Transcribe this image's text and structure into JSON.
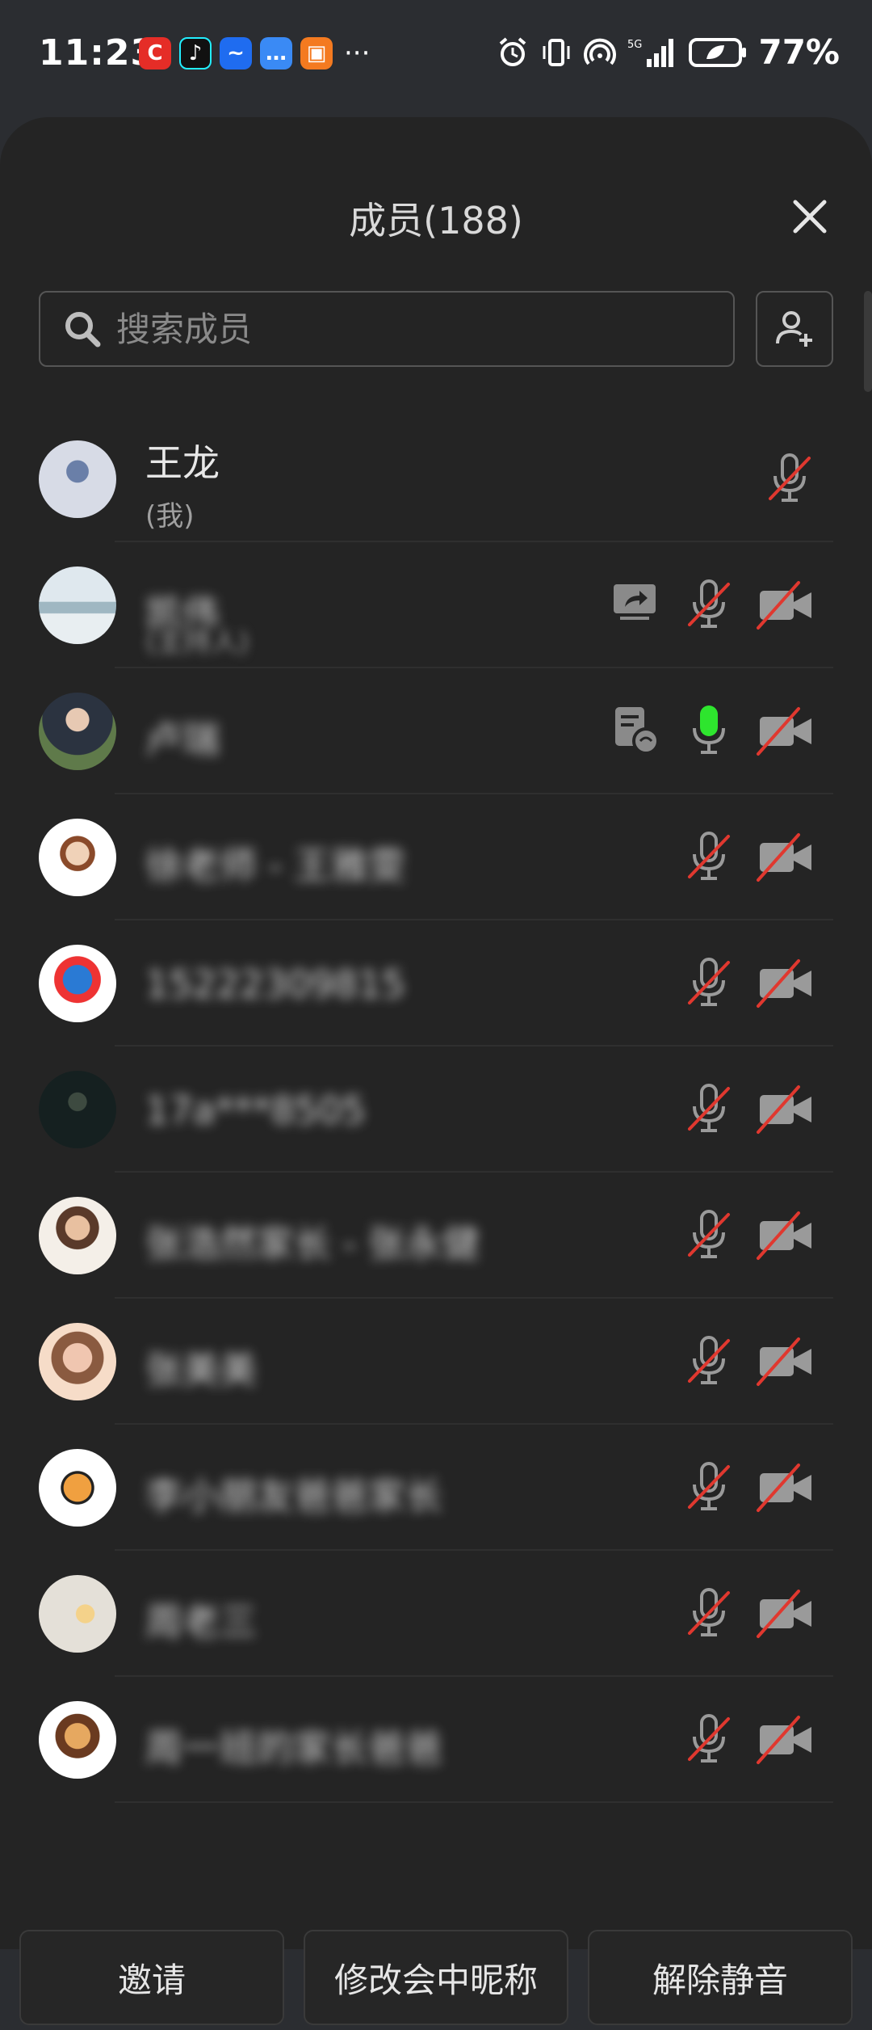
{
  "status_bar": {
    "time": "11:23",
    "battery": "77%",
    "signal_label": "5G"
  },
  "header": {
    "title": "成员(188)"
  },
  "search": {
    "placeholder": "搜索成员"
  },
  "members": [
    {
      "name": "王龙",
      "sub": "(我)",
      "blurred": false,
      "me": true,
      "mic": "muted",
      "camera": "none",
      "extra": "none"
    },
    {
      "name": "凯伟",
      "sub": "(主持人)",
      "blurred": true,
      "me": false,
      "mic": "muted",
      "camera": "off",
      "extra": "share"
    },
    {
      "name": "卢瑞",
      "sub": "",
      "blurred": true,
      "me": false,
      "mic": "active",
      "camera": "off",
      "extra": "note"
    },
    {
      "name": "徐老师 - 王雅雯",
      "sub": "",
      "blurred": true,
      "me": false,
      "mic": "muted",
      "camera": "off",
      "extra": "none"
    },
    {
      "name": "15222309815",
      "sub": "",
      "blurred": true,
      "me": false,
      "mic": "muted",
      "camera": "off",
      "extra": "none"
    },
    {
      "name": "17a***8505",
      "sub": "",
      "blurred": true,
      "me": false,
      "mic": "muted",
      "camera": "off",
      "extra": "none"
    },
    {
      "name": "张浩然家长 - 张永健",
      "sub": "",
      "blurred": true,
      "me": false,
      "mic": "muted",
      "camera": "off",
      "extra": "none"
    },
    {
      "name": "张美美",
      "sub": "",
      "blurred": true,
      "me": false,
      "mic": "muted",
      "camera": "off",
      "extra": "none"
    },
    {
      "name": "李小朋友爸爸家长",
      "sub": "",
      "blurred": true,
      "me": false,
      "mic": "muted",
      "camera": "off",
      "extra": "none"
    },
    {
      "name": "周老三",
      "sub": "",
      "blurred": true,
      "me": false,
      "mic": "muted",
      "camera": "off",
      "extra": "none"
    },
    {
      "name": "周一班的家长爸爸",
      "sub": "",
      "blurred": true,
      "me": false,
      "mic": "muted",
      "camera": "off",
      "extra": "none"
    }
  ],
  "footer": {
    "invite": "邀请",
    "rename": "修改会中昵称",
    "unmute": "解除静音"
  },
  "colors": {
    "background": "#242424",
    "muted_slash": "#e0382f",
    "active_mic": "#2ee52e"
  }
}
